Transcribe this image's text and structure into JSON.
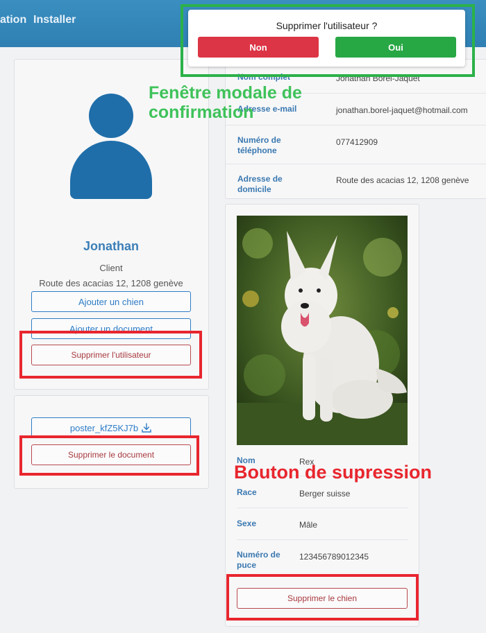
{
  "navbar": {
    "link_partial": "ation",
    "link_install": "Installer"
  },
  "profile": {
    "name": "Jonathan",
    "role": "Client",
    "address": "Route des acacias 12, 1208 genève",
    "btn_add_dog": "Ajouter un chien",
    "btn_add_document": "Ajouter un document",
    "btn_delete_user": "Supprimer l'utilisateur"
  },
  "documents": {
    "file_name": "poster_kfZ5KJ7b",
    "btn_delete_document": "Supprimer le document"
  },
  "user_info": {
    "rows": [
      {
        "label": "Nom complet",
        "value": "Jonathan Borel-Jaquet"
      },
      {
        "label": "Adresse e-mail",
        "value": "jonathan.borel-jaquet@hotmail.com"
      },
      {
        "label": "Numéro de téléphone",
        "value": "077412909"
      },
      {
        "label": "Adresse de domicile",
        "value": "Route des acacias 12, 1208 genève"
      }
    ]
  },
  "dog": {
    "rows": [
      {
        "label": "Nom",
        "value": "Rex"
      },
      {
        "label": "Race",
        "value": "Berger suisse"
      },
      {
        "label": "Sexe",
        "value": "Mâle"
      },
      {
        "label": "Numéro de puce",
        "value": "123456789012345"
      }
    ],
    "btn_delete_dog": "Supprimer le chien"
  },
  "modal": {
    "title": "Supprimer l'utilisateur ?",
    "btn_no": "Non",
    "btn_yes": "Oui"
  },
  "annotations": {
    "modal_label": "Fenêtre modale de confirmation",
    "delete_label": "Bouton de supression"
  },
  "colors": {
    "navbar": "#2f7fb3",
    "accent_blue": "#2e7cc5",
    "danger": "#dc3545",
    "success": "#28a745",
    "annotation_red": "#e8262e",
    "annotation_green": "#2cb14a"
  },
  "icons": {
    "download": "download-icon",
    "avatar": "user-avatar-icon"
  }
}
